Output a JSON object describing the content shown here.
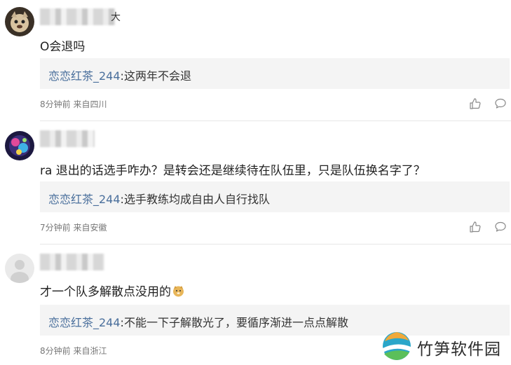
{
  "comments": [
    {
      "username_suffix": "大",
      "text": "O会退吗",
      "reply_author": "恋恋红茶_244",
      "reply_text": ":这两年不会退",
      "time": "8分钟前",
      "location": "来自四川"
    },
    {
      "text": "ra 退出的话选手咋办？是转会还是继续待在队伍里，只是队伍换名字了？",
      "reply_author": "恋恋红茶_244",
      "reply_text": ":选手教练均成自由人自行找队",
      "time": "7分钟前",
      "location": "来自安徽"
    },
    {
      "text": "才一个队多解散点没用的",
      "reply_author": "恋恋红茶_244",
      "reply_text": ":不能一下子解散光了，要循序渐进一点点解散",
      "time": "8分钟前",
      "location": "来自浙江"
    }
  ],
  "watermark": {
    "text": "竹笋软件园"
  },
  "icons": {
    "like": "thumbs-up-icon",
    "reply": "speech-bubble-icon"
  },
  "colors": {
    "reply_author": "#4a6f9c",
    "reply_bg": "#f4f4f4",
    "meta": "#777777"
  }
}
